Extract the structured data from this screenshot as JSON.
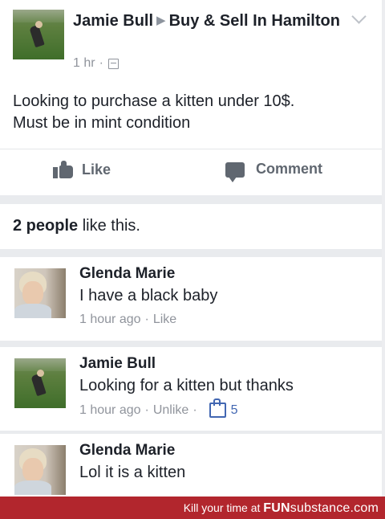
{
  "post": {
    "author": "Jamie Bull",
    "group": "Buy & Sell In Hamilton",
    "time": "1 hr",
    "dot": "·",
    "text_line1": "Looking to purchase a kitten under 10$.",
    "text_line2": "Must be in mint condition",
    "like_label": "Like",
    "comment_label": "Comment"
  },
  "likes_summary": {
    "count_text": "2 people",
    "suffix": "like this."
  },
  "comments": [
    {
      "name": "Glenda Marie",
      "text": "I have a black baby",
      "time": "1 hour ago",
      "action": "Like"
    },
    {
      "name": "Jamie Bull",
      "text": "Looking for a kitten but thanks",
      "time": "1 hour ago",
      "action": "Unlike",
      "likes": "5"
    },
    {
      "name": "Glenda Marie",
      "text": "Lol it is a kitten"
    }
  ],
  "footer": {
    "tagline": "Kill your time at",
    "brand_fun": "FUN",
    "brand_sub": "substance",
    "brand_tld": ".com"
  },
  "colors": {
    "link_blue": "#4267b2",
    "footer_red": "#b2262d",
    "muted_gray": "#90949c"
  }
}
